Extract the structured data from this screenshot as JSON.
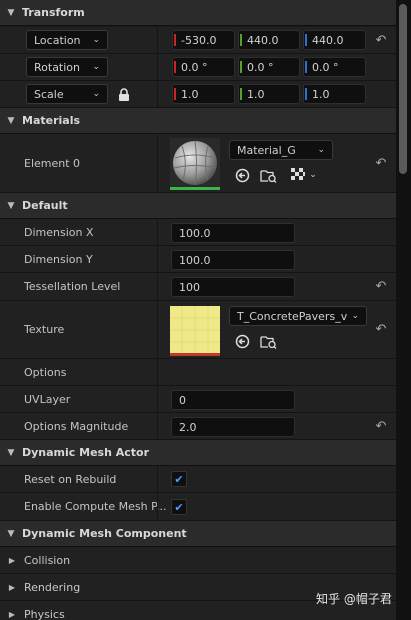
{
  "transform": {
    "title": "Transform",
    "location": {
      "label": "Location",
      "x": "-530.0",
      "y": "440.0",
      "z": "440.0"
    },
    "rotation": {
      "label": "Rotation",
      "x": "0.0 °",
      "y": "0.0 °",
      "z": "0.0 °"
    },
    "scale": {
      "label": "Scale",
      "x": "1.0",
      "y": "1.0",
      "z": "1.0"
    }
  },
  "materials": {
    "title": "Materials",
    "element_label": "Element 0",
    "material_name": "Material_G"
  },
  "default": {
    "title": "Default",
    "dimension_x": {
      "label": "Dimension X",
      "value": "100.0"
    },
    "dimension_y": {
      "label": "Dimension Y",
      "value": "100.0"
    },
    "tessellation": {
      "label": "Tessellation Level",
      "value": "100"
    },
    "texture": {
      "label": "Texture",
      "name": "T_ConcretePavers_v"
    },
    "options_label": "Options",
    "uvlayer": {
      "label": "UVLayer",
      "value": "0"
    },
    "options_magnitude": {
      "label": "Options Magnitude",
      "value": "2.0"
    }
  },
  "dynamic_mesh_actor": {
    "title": "Dynamic Mesh Actor",
    "reset_on_rebuild": {
      "label": "Reset on Rebuild",
      "checked": true
    },
    "enable_compute": {
      "label": "Enable Compute Mesh P...",
      "checked": true
    }
  },
  "dynamic_mesh_component": {
    "title": "Dynamic Mesh Component",
    "items": [
      "Collision",
      "Rendering",
      "Physics"
    ]
  },
  "watermark": "知乎 @帽子君",
  "colors": {
    "x_axis": "#c62828",
    "y_axis": "#5aa02c",
    "z_axis": "#2f6fd0",
    "check": "#4da0ff"
  }
}
